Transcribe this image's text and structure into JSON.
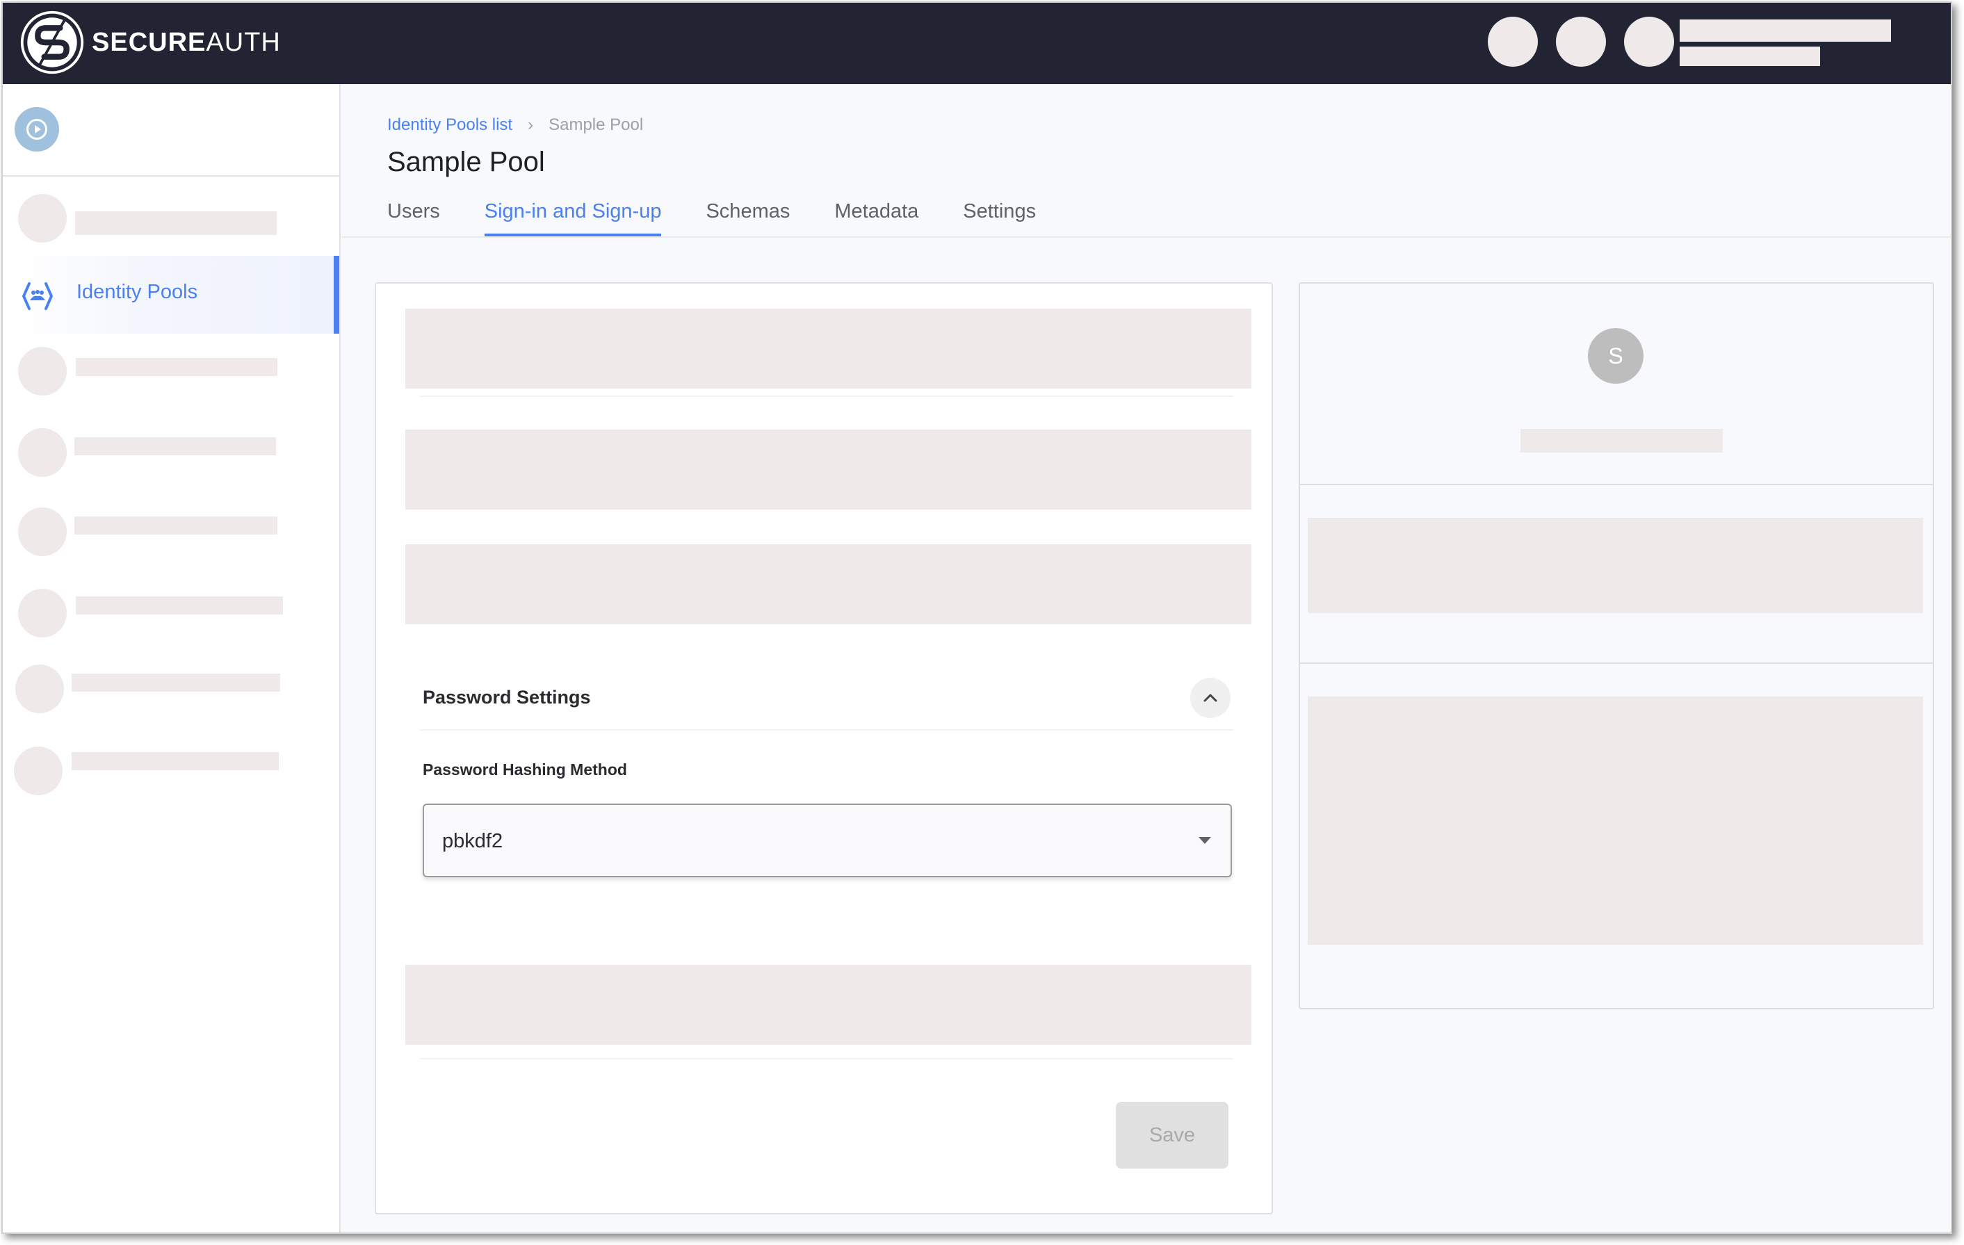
{
  "header": {
    "brand_bold": "SECURE",
    "brand_light": "AUTH",
    "logo_icon": "secureauth-logo-icon"
  },
  "sidebar": {
    "brand_icon": "play-circle-icon",
    "active_item": {
      "label": "Identity Pools",
      "icon": "identity-pools-icon"
    }
  },
  "breadcrumb": {
    "link": "Identity Pools list",
    "separator": "›",
    "current": "Sample Pool"
  },
  "page": {
    "title": "Sample Pool"
  },
  "tabs": [
    {
      "label": "Users",
      "active": false
    },
    {
      "label": "Sign-in and Sign-up",
      "active": true
    },
    {
      "label": "Schemas",
      "active": false
    },
    {
      "label": "Metadata",
      "active": false
    },
    {
      "label": "Settings",
      "active": false
    }
  ],
  "password_settings": {
    "title": "Password Settings",
    "collapse_icon": "chevron-up-icon",
    "hashing_label": "Password Hashing Method",
    "hashing_value": "pbkdf2",
    "dropdown_icon": "caret-down-icon"
  },
  "actions": {
    "save_label": "Save",
    "save_disabled": true
  },
  "side_card": {
    "avatar_initial": "S"
  },
  "colors": {
    "header_bg": "#222433",
    "accent": "#4a80f0",
    "placeholder": "#efe9e9",
    "avatar_bg": "#bdbdbd"
  }
}
